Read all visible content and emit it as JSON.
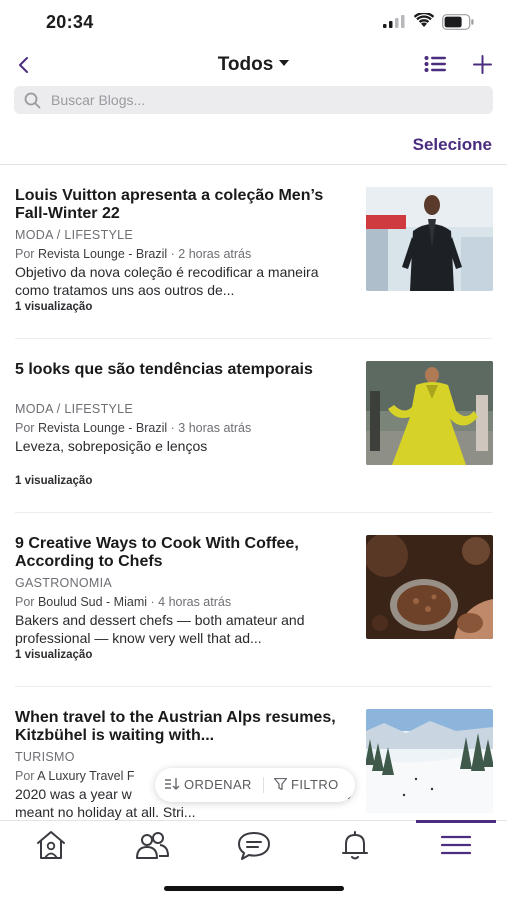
{
  "status_bar": {
    "time": "20:34"
  },
  "header": {
    "title": "Todos",
    "select_label": "Selecione"
  },
  "search": {
    "placeholder": "Buscar Blogs..."
  },
  "articles": [
    {
      "title": "Louis Vuitton apresenta a coleção Men’s Fall-Winter 22",
      "category": "MODA / LIFESTYLE",
      "by": "Por",
      "source": "Revista Lounge - Brazil",
      "time": "2 horas atrás",
      "excerpt": "Objetivo da nova coleção é recodificar a maneira como tratamos uns aos outros de...",
      "views": "1 visualização"
    },
    {
      "title": "5 looks que são tendências atemporais",
      "category": "MODA / LIFESTYLE",
      "by": "Por",
      "source": "Revista Lounge - Brazil",
      "time": "3 horas atrás",
      "excerpt": "Leveza, sobreposição e lenços",
      "views": "1 visualização"
    },
    {
      "title": "9 Creative Ways to Cook With Coffee, According to Chefs",
      "category": "GASTRONOMIA",
      "by": "Por",
      "source": "Boulud Sud - Miami",
      "time": "4 horas atrás",
      "excerpt": "Bakers and dessert chefs — both amateur and professional — know very well that ad...",
      "views": "1 visualização"
    },
    {
      "title": "When travel to the Austrian Alps resumes, Kitzbühel is waiting with...",
      "category": "TURISMO",
      "by": "Por",
      "source": "A Luxury Travel F",
      "time": "",
      "excerpt": "2020 was a year w                                 many that also meant no holiday at all. Stri...",
      "views": ""
    }
  ],
  "floating_bar": {
    "sort_label": "ORDENAR",
    "filter_label": "FILTRO"
  },
  "tab_bar": {
    "items": [
      "home-icon",
      "groups-icon",
      "chat-icon",
      "notifications-icon",
      "menu-icon"
    ],
    "active": "menu-icon"
  },
  "colors": {
    "accent": "#4a2d7e",
    "search_bg": "#ececee",
    "secondary_text": "#6e6e74"
  }
}
